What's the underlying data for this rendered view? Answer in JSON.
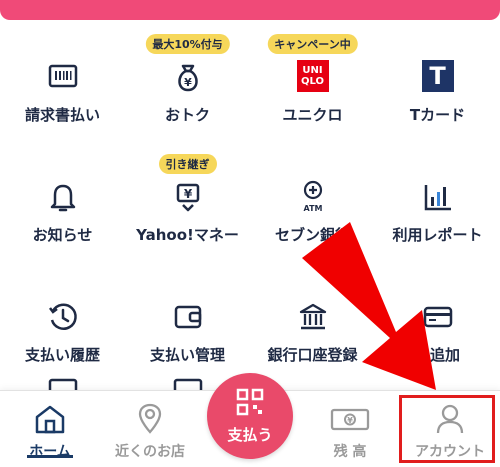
{
  "colors": {
    "accent": "#f04a78",
    "navy": "#1f2a44",
    "badge": "#f6d75a",
    "pay": "#e94a6a",
    "red": "#e11d1d"
  },
  "menu": {
    "items": [
      {
        "label": "請求書払い",
        "icon": "invoice-icon",
        "badge": ""
      },
      {
        "label": "おトク",
        "icon": "money-bag-icon",
        "badge": "最大10%付与"
      },
      {
        "label": "ユニクロ",
        "icon": "uniqlo-logo",
        "badge": "キャンペーン中"
      },
      {
        "label": "Tカード",
        "icon": "tcard-logo",
        "badge": ""
      },
      {
        "label": "お知らせ",
        "icon": "bell-icon",
        "badge": ""
      },
      {
        "label": "Yahoo!マネー",
        "icon": "yahoo-money-icon",
        "badge": "引き継ぎ"
      },
      {
        "label": "セブン銀行",
        "icon": "atm-icon",
        "badge": ""
      },
      {
        "label": "利用レポート",
        "icon": "report-chart-icon",
        "badge": ""
      },
      {
        "label": "支払い履歴",
        "icon": "history-clock-icon",
        "badge": ""
      },
      {
        "label": "支払い管理",
        "icon": "wallet-icon",
        "badge": ""
      },
      {
        "label": "銀行口座登録",
        "icon": "bank-icon",
        "badge": ""
      },
      {
        "label": "ド追加",
        "icon": "card-icon",
        "badge": ""
      }
    ],
    "uniqlo_logo": {
      "line1": "UNI",
      "line2": "QLO"
    },
    "tcard_logo": "T",
    "atm_text": "ATM",
    "yen": "¥"
  },
  "bottom_nav": {
    "home": "ホーム",
    "nearby": "近くのお店",
    "pay": "支払う",
    "balance": "残 高",
    "account": "アカウント"
  }
}
